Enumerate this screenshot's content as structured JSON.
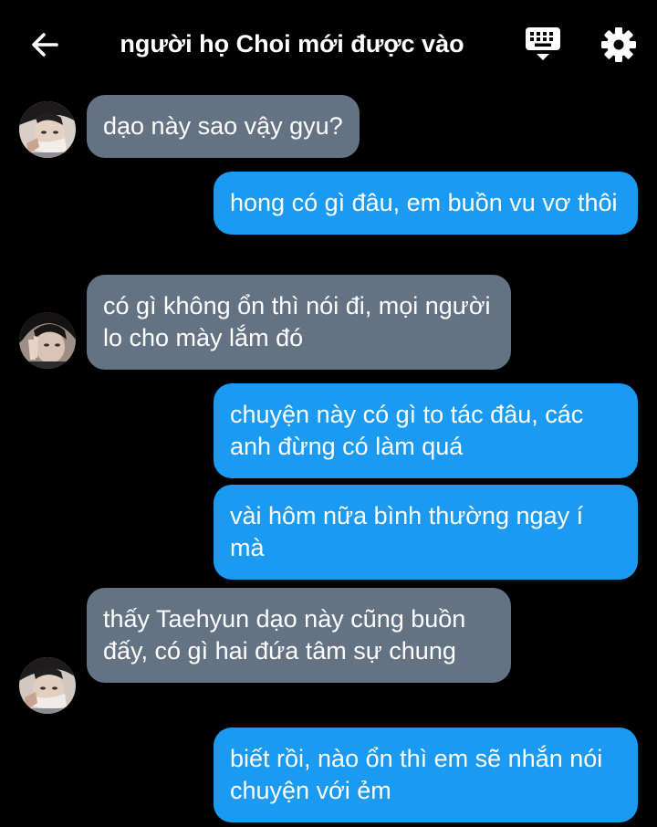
{
  "header": {
    "title": "người họ Choi mới được vào",
    "back_icon": "arrow-left-icon",
    "keyboard_icon": "keyboard-icon",
    "settings_icon": "gear-icon"
  },
  "colors": {
    "background": "#000000",
    "incoming_bubble": "#637383",
    "outgoing_bubble": "#1a9af0",
    "text": "#ffffff"
  },
  "messages": [
    {
      "direction": "incoming",
      "text": "dạo này sao vậy gyu?"
    },
    {
      "direction": "outgoing",
      "text": "hong có gì đâu, em buồn vu vơ thôi"
    },
    {
      "direction": "incoming",
      "text": "có gì không ổn thì nói đi, mọi người lo cho mày lắm đó"
    },
    {
      "direction": "outgoing",
      "text": "chuyện này có gì to tác đâu, các anh đừng có làm quá"
    },
    {
      "direction": "outgoing",
      "text": "vài hôm nữa bình thường ngay í mà"
    },
    {
      "direction": "incoming",
      "text": "thấy Taehyun dạo này cũng buồn đấy, có gì hai đứa tâm sự chung"
    },
    {
      "direction": "outgoing",
      "text": "biết rồi, nào ổn thì em sẽ nhắn nói chuyện với ẻm"
    }
  ]
}
